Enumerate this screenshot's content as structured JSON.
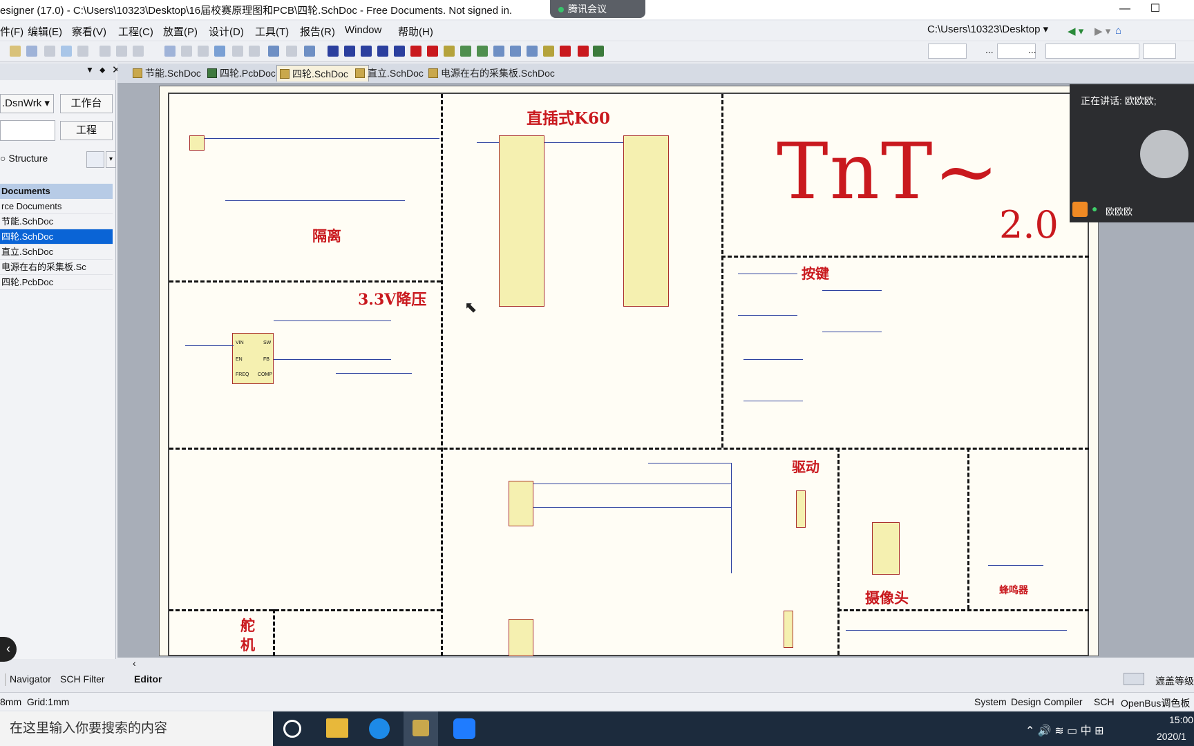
{
  "window": {
    "title": "esigner (17.0) - C:\\Users\\10323\\Desktop\\16届校赛原理图和PCB\\四轮.SchDoc - Free Documents. Not signed in.",
    "meeting_label": "腾讯会议",
    "controls": [
      "—",
      "☐"
    ]
  },
  "menubar": {
    "items": [
      "件(F)",
      "编辑(E)",
      "察看(V)",
      "工程(C)",
      "放置(P)",
      "设计(D)",
      "工具(T)",
      "报告(R)",
      "Window",
      "帮助(H)"
    ],
    "path_combo": "C:\\Users\\10323\\Desktop"
  },
  "toolbar": {
    "combo_value_1": "...",
    "combo_value_2": "..."
  },
  "left_panel": {
    "workspace_combo": ".DsnWrk",
    "workspace_button": "工作台",
    "project_button": "工程",
    "structure_label": "Structure",
    "tree_header": "Documents",
    "rows": [
      "rce Documents",
      "节能.SchDoc",
      "四轮.SchDoc",
      "直立.SchDoc",
      "电源在右的采集板.Sc",
      "四轮.PcbDoc"
    ],
    "selected_index": 2,
    "bottom_tabs": [
      "Navigator",
      "SCH Filter"
    ]
  },
  "doc_tabs": [
    {
      "label": "节能.SchDoc",
      "active": false
    },
    {
      "label": "四轮.PcbDoc",
      "active": false
    },
    {
      "label": "四轮.SchDoc",
      "active": true
    },
    {
      "label": "直立.SchDoc",
      "active": false
    },
    {
      "label": "电源在右的采集板.SchDoc",
      "active": false
    }
  ],
  "schematic": {
    "title_k60": "直插式K60",
    "label_isolation": "隔离",
    "label_buck": "3.3V降压",
    "label_keys": "按键",
    "label_drive": "驱动",
    "label_camera": "摄像头",
    "label_servo_1": "舵",
    "label_servo_2": "机",
    "label_buzzer": "蜂鸣器",
    "brand": "TnT~",
    "version": "2.0",
    "chip_labels": [
      "VIN",
      "SW",
      "EN",
      "FB",
      "FREQ",
      "COMP"
    ]
  },
  "video_overlay": {
    "speaking": "正在讲话: 欧欧欧;",
    "participant": "欧欧欧"
  },
  "editor": {
    "tab_label": "Editor",
    "right_label": "遮盖等级"
  },
  "statusbar": {
    "left": "8mm  Grid:1mm",
    "right_items": [
      "System",
      "Design Compiler",
      "SCH",
      "OpenBus调色板"
    ]
  },
  "taskbar": {
    "search_placeholder": "在这里输入你要搜索的内容",
    "time": "15:00",
    "date": "2020/1",
    "tray_lang": "中"
  },
  "colors": {
    "schematic_red": "#c9191e",
    "wire_blue": "#2b3f9e",
    "chip_yellow": "#f5f0b0",
    "selection_blue": "#0a64d6"
  }
}
